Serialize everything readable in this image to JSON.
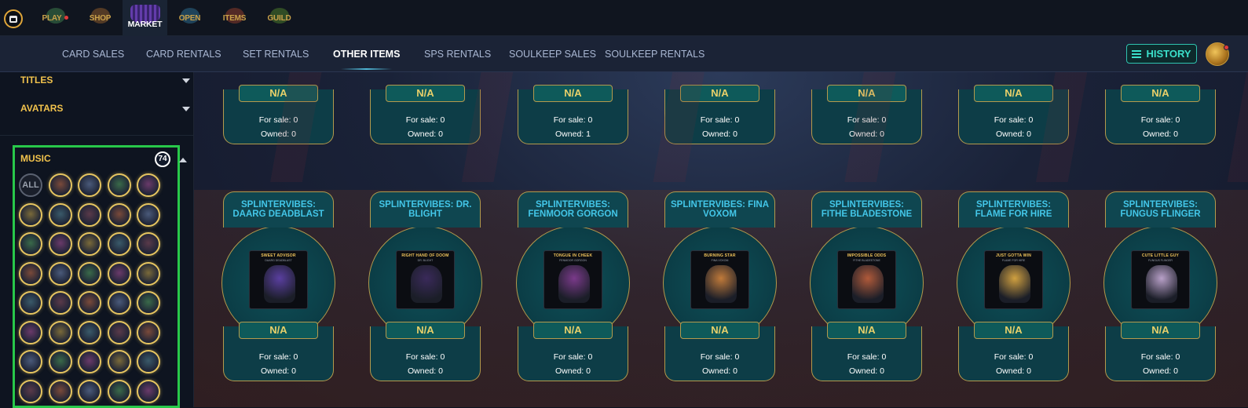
{
  "topnav": {
    "items": [
      {
        "label": "PLAY",
        "has_dot": true,
        "icon": "play-icon",
        "color": "#3c7a4a"
      },
      {
        "label": "SHOP",
        "has_dot": false,
        "icon": "shop-icon",
        "color": "#8a5a2a"
      },
      {
        "label": "MARKET",
        "has_dot": false,
        "icon": "market-icon",
        "active": true,
        "color": "#6b3fb8"
      },
      {
        "label": "OPEN",
        "has_dot": false,
        "icon": "open-icon",
        "color": "#2b6a8a"
      },
      {
        "label": "ITEMS",
        "has_dot": false,
        "icon": "items-icon",
        "color": "#8a3a2a"
      },
      {
        "label": "GUILD",
        "has_dot": false,
        "icon": "guild-icon",
        "color": "#4a7a2a"
      }
    ]
  },
  "subnav": {
    "tabs": [
      {
        "label": "CARD SALES",
        "active": false
      },
      {
        "label": "CARD RENTALS",
        "active": false
      },
      {
        "label": "SET RENTALS",
        "active": false
      },
      {
        "label": "OTHER ITEMS",
        "active": true
      },
      {
        "label": "SPS RENTALS",
        "active": false
      },
      {
        "label": "SOULKEEP SALES",
        "active": false
      },
      {
        "label": "SOULKEEP RENTALS",
        "active": false
      }
    ],
    "history_label": "HISTORY"
  },
  "sidebar": {
    "filters": [
      {
        "label": "TITLES"
      },
      {
        "label": "AVATARS"
      }
    ],
    "music": {
      "label": "MUSIC",
      "count": "74",
      "all_label": "ALL",
      "thumb_count": 39
    }
  },
  "cards_top": [
    {
      "price": "N/A",
      "for_sale": "For sale: 0",
      "owned": "Owned: 0"
    },
    {
      "price": "N/A",
      "for_sale": "For sale: 0",
      "owned": "Owned: 0"
    },
    {
      "price": "N/A",
      "for_sale": "For sale: 0",
      "owned": "Owned: 1"
    },
    {
      "price": "N/A",
      "for_sale": "For sale: 0",
      "owned": "Owned: 0"
    },
    {
      "price": "N/A",
      "for_sale": "For sale: 0",
      "owned": "Owned: 0"
    },
    {
      "price": "N/A",
      "for_sale": "For sale: 0",
      "owned": "Owned: 0"
    },
    {
      "price": "N/A",
      "for_sale": "For sale: 0",
      "owned": "Owned: 0"
    }
  ],
  "cards_bottom": [
    {
      "title": "SPLINTERVIBES: DAARG DEADBLAST",
      "art_title": "SWEET ADVISOR",
      "art_sub": "DAARG DEADBLAST",
      "art_color": "#5a3fa0",
      "price": "N/A",
      "for_sale": "For sale: 0",
      "owned": "Owned: 0"
    },
    {
      "title": "SPLINTERVIBES: DR. BLIGHT",
      "art_title": "RIGHT HAND OF DOOM",
      "art_sub": "DR. BLIGHT",
      "art_color": "#3a2a5a",
      "price": "N/A",
      "for_sale": "For sale: 0",
      "owned": "Owned: 0"
    },
    {
      "title": "SPLINTERVIBES: FENMOOR GORGON",
      "art_title": "TONGUE IN CHEEK",
      "art_sub": "FENMOOR GORGON",
      "art_color": "#7a3a8a",
      "price": "N/A",
      "for_sale": "For sale: 0",
      "owned": "Owned: 0"
    },
    {
      "title": "SPLINTERVIBES: FINA VOXOM",
      "art_title": "BURNING STAR",
      "art_sub": "FINA VOXOM",
      "art_color": "#c07a3a",
      "price": "N/A",
      "for_sale": "For sale: 0",
      "owned": "Owned: 0"
    },
    {
      "title": "SPLINTERVIBES: FITHE BLADESTONE",
      "art_title": "IMPOSSIBLE ODDS",
      "art_sub": "FITHE BLADESTONE",
      "art_color": "#b05a3a",
      "price": "N/A",
      "for_sale": "For sale: 0",
      "owned": "Owned: 0"
    },
    {
      "title": "SPLINTERVIBES: FLAME FOR HIRE",
      "art_title": "JUST GOTTA WIN",
      "art_sub": "FLAME FOR HIRE",
      "art_color": "#d0a040",
      "price": "N/A",
      "for_sale": "For sale: 0",
      "owned": "Owned: 0"
    },
    {
      "title": "SPLINTERVIBES: FUNGUS FLINGER",
      "art_title": "CUTE LITTLE GUY",
      "art_sub": "FUNGUS FLINGER",
      "art_color": "#b8a0c8",
      "price": "N/A",
      "for_sale": "For sale: 0",
      "owned": "Owned: 0"
    }
  ]
}
